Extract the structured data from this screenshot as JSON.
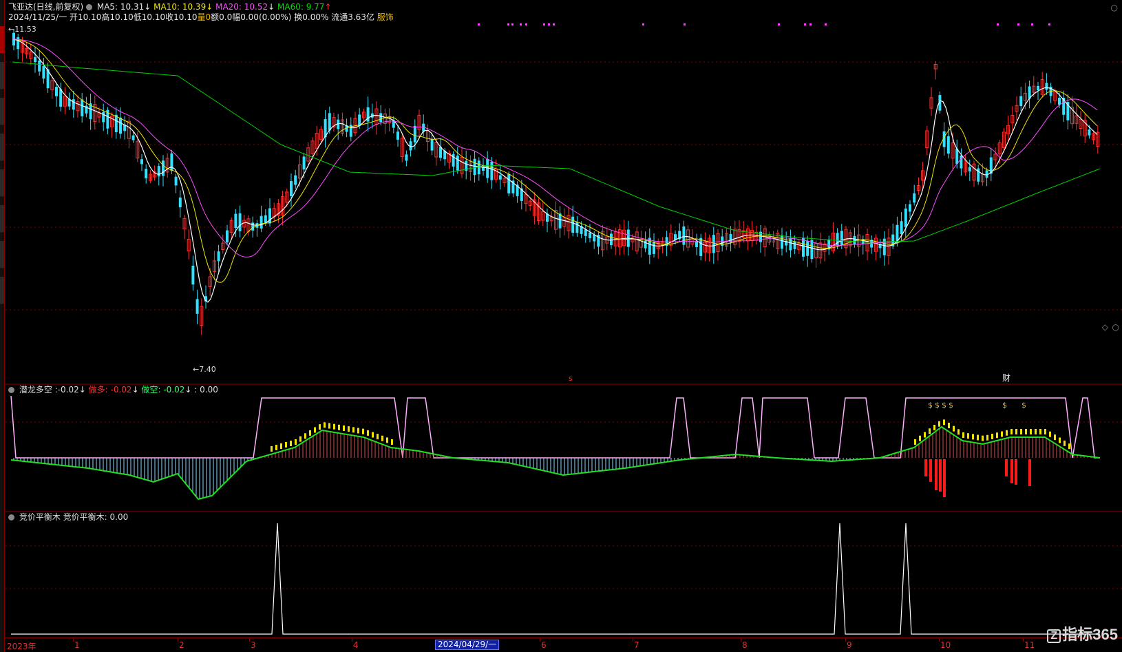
{
  "header": {
    "stock_name": "飞亚达(日线,前复权)",
    "ma5": "MA5: 10.31",
    "ma10": "MA10: 10.39",
    "ma20": "MA20: 10.52",
    "ma60": "MA60: 9.77",
    "arrow_down": "↓",
    "arrow_up": "↑",
    "quote_date": "2024/11/25/一",
    "open": "开10.10",
    "high": "高10.10",
    "low": "低10.10",
    "close": "收10.10",
    "volume": "量0",
    "amount": "额0.0",
    "change": "幅0.00(0.00%)",
    "turnover": "换0.00%",
    "float_cap": "流通3.63亿",
    "industry": "服饰"
  },
  "price_marks": {
    "high": "11.53",
    "low": "7.40",
    "high_arrow": "←",
    "low_arrow": "←"
  },
  "event_marks": {
    "s_mark": "s",
    "cai_mark": "财"
  },
  "panel2": {
    "name": "潜龙多空",
    "value": ":-0.02",
    "zuoduo": "做多: -0.02",
    "zuokong": "做空: -0.02",
    "extra": ": 0.00",
    "signal_glyph": "$"
  },
  "panel3": {
    "name": "竞价平衡木",
    "series_label": "竞价平衡木: 0.00"
  },
  "axis": {
    "year_label": "2023年",
    "months": [
      "1",
      "2",
      "3",
      "4",
      "6",
      "7",
      "8",
      "9",
      "10",
      "11"
    ],
    "highlight_date": "2024/04/29/一"
  },
  "brand": {
    "logo_letter": "Z",
    "text": "指标365"
  },
  "icons": {
    "dot": "settings-dot-icon",
    "diamond": "diamond-icon",
    "circle": "circle-icon"
  },
  "colors": {
    "up": "#ff3030",
    "down": "#33e0ff",
    "ma5": "#ffffff",
    "ma10": "#f2e600",
    "ma20": "#ff4dff",
    "ma60": "#00d000",
    "grid": "#8b0000"
  }
}
